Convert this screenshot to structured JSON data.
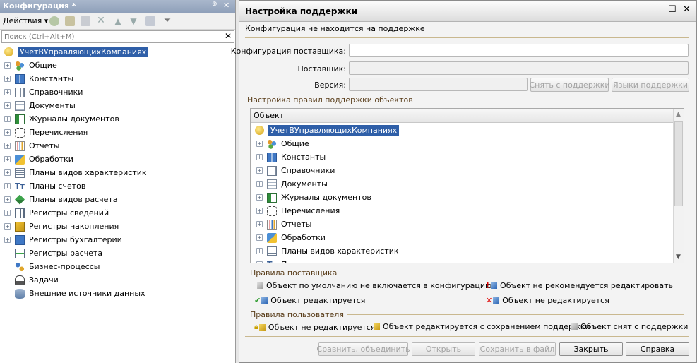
{
  "left": {
    "title": "Конфигурация *",
    "actions_label": "Действия",
    "search_placeholder": "Поиск (Ctrl+Alt+M)",
    "root": "УчетВУправляющихКомпаниях",
    "items": [
      {
        "label": "Общие",
        "icon": "common-icon",
        "expand": true
      },
      {
        "label": "Константы",
        "icon": "constants-icon",
        "expand": true
      },
      {
        "label": "Справочники",
        "icon": "catalogs-icon",
        "expand": true
      },
      {
        "label": "Документы",
        "icon": "documents-icon",
        "expand": true
      },
      {
        "label": "Журналы документов",
        "icon": "journals-icon",
        "expand": true
      },
      {
        "label": "Перечисления",
        "icon": "enums-icon",
        "expand": true
      },
      {
        "label": "Отчеты",
        "icon": "reports-icon",
        "expand": true
      },
      {
        "label": "Обработки",
        "icon": "processing-icon",
        "expand": true
      },
      {
        "label": "Планы видов характеристик",
        "icon": "chart-of-characteristics-icon",
        "expand": true
      },
      {
        "label": "Планы счетов",
        "icon": "chart-of-accounts-icon",
        "expand": true
      },
      {
        "label": "Планы видов расчета",
        "icon": "chart-of-calc-icon",
        "expand": true
      },
      {
        "label": "Регистры сведений",
        "icon": "info-register-icon",
        "expand": true
      },
      {
        "label": "Регистры накопления",
        "icon": "accum-register-icon",
        "expand": true
      },
      {
        "label": "Регистры бухгалтерии",
        "icon": "accounting-register-icon",
        "expand": true
      },
      {
        "label": "Регистры расчета",
        "icon": "calc-register-icon",
        "expand": false
      },
      {
        "label": "Бизнес-процессы",
        "icon": "business-process-icon",
        "expand": false
      },
      {
        "label": "Задачи",
        "icon": "tasks-icon",
        "expand": false
      },
      {
        "label": "Внешние источники данных",
        "icon": "external-sources-icon",
        "expand": false
      }
    ]
  },
  "dialog": {
    "title": "Настройка поддержки",
    "status": "Конфигурация не находится на поддержке",
    "vendor_config_label": "Конфигурация поставщика:",
    "vendor_label": "Поставщик:",
    "version_label": "Версия:",
    "remove_support_btn": "Снять с поддержки",
    "support_langs_btn": "Языки поддержки",
    "rules_group": "Настройка правил поддержки объектов",
    "tree_header": "Объект",
    "tree_root": "УчетВУправляющихКомпаниях",
    "tree_items": [
      {
        "label": "Общие",
        "icon": "common-icon"
      },
      {
        "label": "Константы",
        "icon": "constants-icon"
      },
      {
        "label": "Справочники",
        "icon": "catalogs-icon"
      },
      {
        "label": "Документы",
        "icon": "documents-icon"
      },
      {
        "label": "Журналы документов",
        "icon": "journals-icon"
      },
      {
        "label": "Перечисления",
        "icon": "enums-icon"
      },
      {
        "label": "Отчеты",
        "icon": "reports-icon"
      },
      {
        "label": "Обработки",
        "icon": "processing-icon"
      },
      {
        "label": "Планы видов характеристик",
        "icon": "chart-of-characteristics-icon"
      },
      {
        "label": "Планы счетов",
        "icon": "chart-of-accounts-icon"
      }
    ],
    "vendor_rules_title": "Правила поставщика",
    "vendor_rules": [
      "Объект по умолчанию не включается в конфигурацию",
      "Объект не рекомендуется редактировать",
      "Объект редактируется",
      "Объект не редактируется"
    ],
    "user_rules_title": "Правила пользователя",
    "user_rules": [
      "Объект не редактируется",
      "Объект редактируется с сохранением поддержки",
      "Объект снят с поддержки"
    ],
    "buttons": {
      "compare": "Сравнить, объединить",
      "open": "Открыть",
      "save": "Сохранить в файл",
      "close": "Закрыть",
      "help": "Справка"
    }
  }
}
